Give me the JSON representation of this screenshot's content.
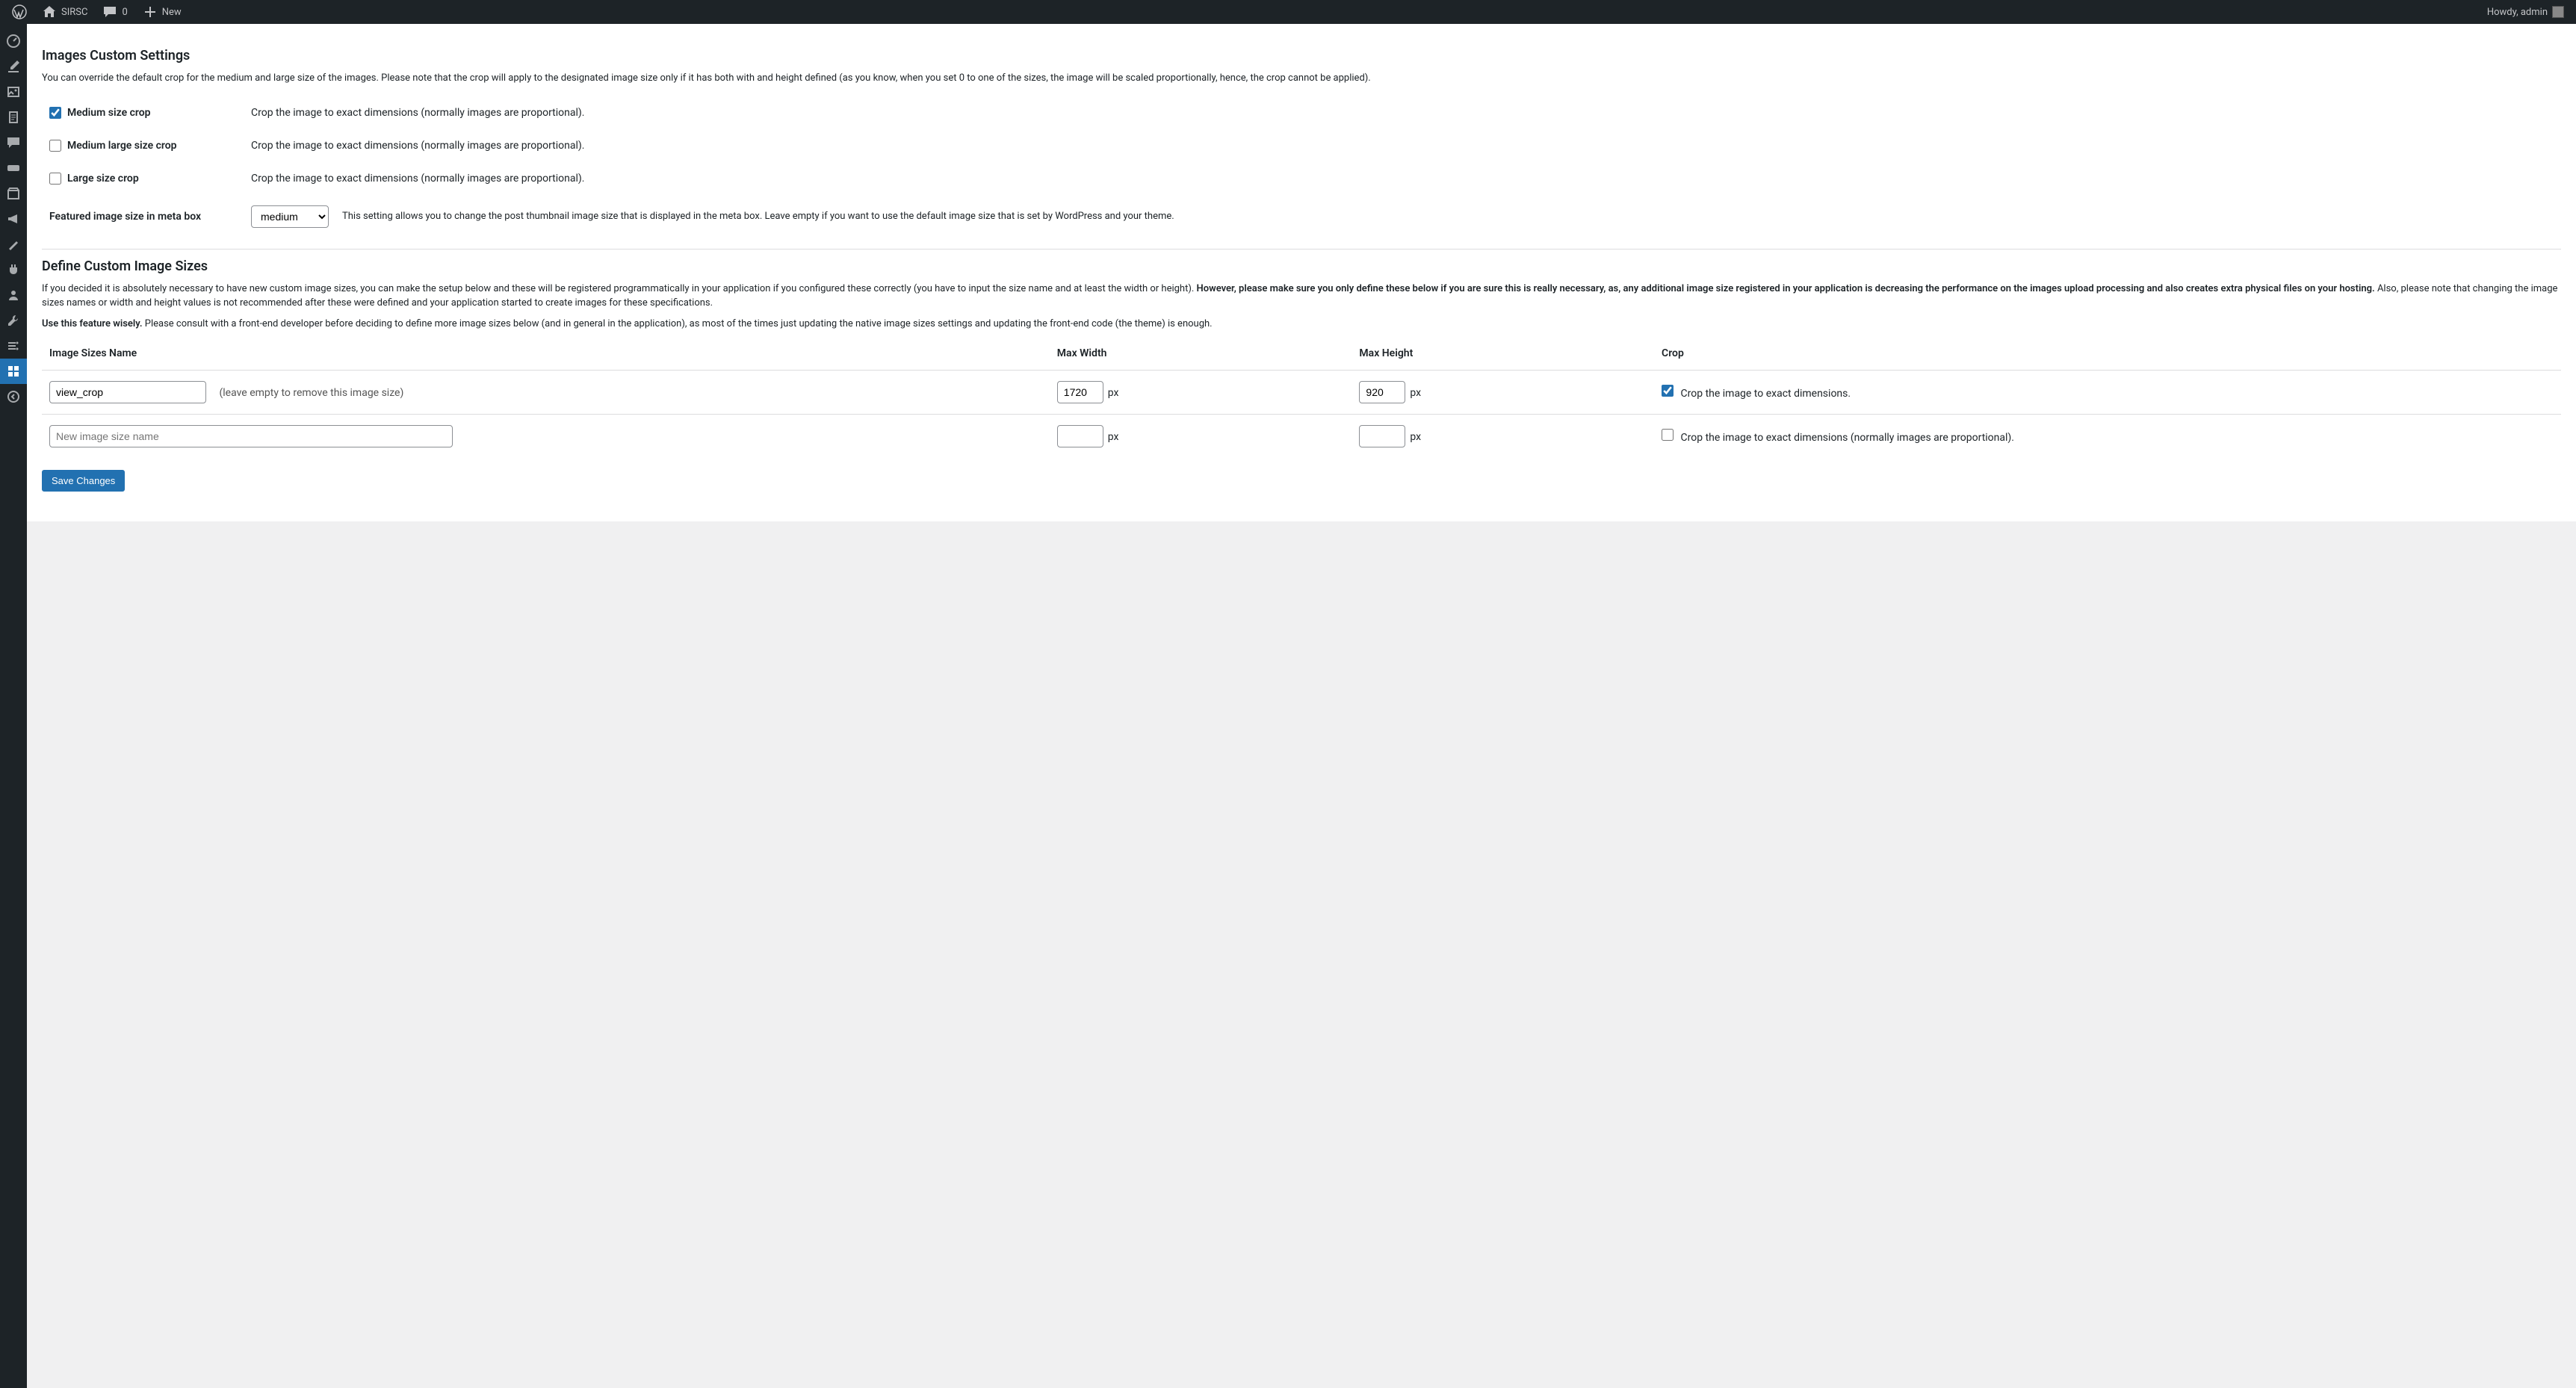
{
  "topbar": {
    "site_name": "SIRSC",
    "comments_count": "0",
    "new_label": "New",
    "howdy": "Howdy, admin"
  },
  "section1": {
    "heading": "Images Custom Settings",
    "intro": "You can override the default crop for the medium and large size of the images. Please note that the crop will apply to the designated image size only if it has both with and height defined (as you know, when you set 0 to one of the sizes, the image will be scaled proportionally, hence, the crop cannot be applied).",
    "rows": {
      "medium_label": "Medium size crop",
      "medium_desc": "Crop the image to exact dimensions (normally images are proportional).",
      "medlarge_label": "Medium large size crop",
      "medlarge_desc": "Crop the image to exact dimensions (normally images are proportional).",
      "large_label": "Large size crop",
      "large_desc": "Crop the image to exact dimensions (normally images are proportional).",
      "feat_label": "Featured image size in meta box",
      "feat_select": "medium",
      "feat_desc": "This setting allows you to change the post thumbnail image size that is displayed in the meta box. Leave empty if you want to use the default image size that is set by WordPress and your theme."
    }
  },
  "section2": {
    "heading": "Define Custom Image Sizes",
    "p1_a": "If you decided it is absolutely necessary to have new custom image sizes, you can make the setup below and these will be registered programmatically in your application if you configured these correctly (you have to input the size name and at least the width or height). ",
    "p1_b": "However, please make sure you only define these below if you are sure this is really necessary, as, any additional image size registered in your application is decreasing the performance on the images upload processing and also creates extra physical files on your hosting.",
    "p1_c": " Also, please note that changing the image sizes names or width and height values is not recommended after these were defined and your application started to create images for these specifications.",
    "p2_a": "Use this feature wisely.",
    "p2_b": " Please consult with a front-end developer before deciding to define more image sizes below (and in general in the application), as most of the times just updating the native image sizes settings and updating the front-end code (the theme) is enough.",
    "head_name": "Image Sizes Name",
    "head_w": "Max Width",
    "head_h": "Max Height",
    "head_c": "Crop",
    "row1": {
      "name": "view_crop",
      "hint": "(leave empty to remove this image size)",
      "w": "1720",
      "h": "920",
      "crop_label": "Crop the image to exact dimensions."
    },
    "row2": {
      "placeholder": "New image size name",
      "crop_label": "Crop the image to exact dimensions (normally images are proportional)."
    },
    "px": "px"
  },
  "save_label": "Save Changes"
}
